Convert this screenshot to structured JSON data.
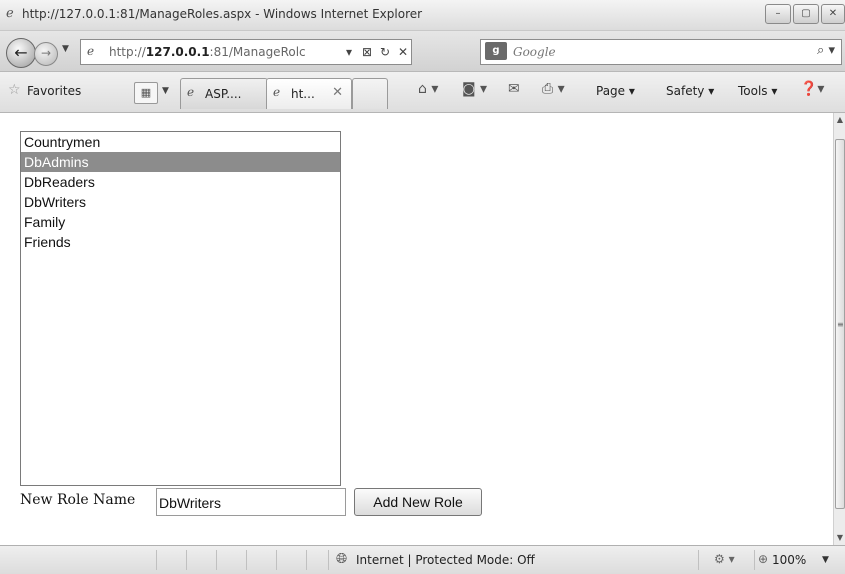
{
  "window": {
    "title": "http://127.0.0.1:81/ManageRoles.aspx - Windows Internet Explorer",
    "minimize": "–",
    "maximize": "▢",
    "close": "✕"
  },
  "address_bar": {
    "url_prefix": "http://",
    "url_host": "127.0.0.1",
    "url_rest": ":81/ManageRolc",
    "search_placeholder": "Google"
  },
  "command_bar": {
    "favorites_label": "Favorites",
    "tabs": [
      {
        "label": "ASP....",
        "active": false
      },
      {
        "label": "ht...",
        "active": true
      }
    ],
    "page_label": "Page ▾",
    "safety_label": "Safety ▾",
    "tools_label": "Tools ▾"
  },
  "roles_list": {
    "items": [
      "Countrymen",
      "DbAdmins",
      "DbReaders",
      "DbWriters",
      "Family",
      "Friends"
    ],
    "selected": "DbAdmins"
  },
  "form": {
    "new_role_label": "New Role Name",
    "new_role_value": "DbWriters",
    "add_button_label": "Add New Role"
  },
  "status_bar": {
    "zone_text": "Internet | Protected Mode: Off",
    "zoom": "100%"
  },
  "colors": {
    "selection": "#8c8c8c",
    "chrome_light": "#f1f1f1",
    "chrome_dark": "#dcdcdc"
  }
}
